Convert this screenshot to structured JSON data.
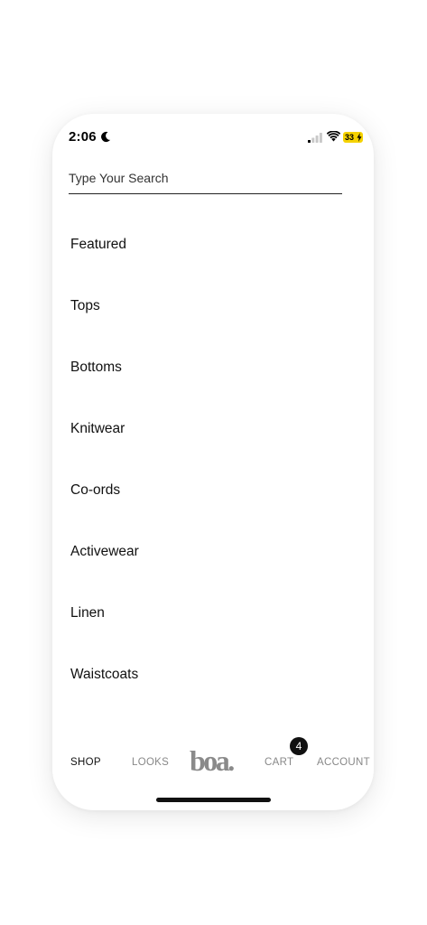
{
  "status_bar": {
    "time": "2:06",
    "battery_level": "33",
    "icons": [
      "moon-icon",
      "signal-icon",
      "wifi-icon",
      "battery-charging-icon"
    ]
  },
  "search": {
    "placeholder": "Type Your Search",
    "value": ""
  },
  "categories": [
    {
      "label": "Featured"
    },
    {
      "label": "Tops"
    },
    {
      "label": "Bottoms"
    },
    {
      "label": "Knitwear"
    },
    {
      "label": "Co-ords"
    },
    {
      "label": "Activewear"
    },
    {
      "label": "Linen"
    },
    {
      "label": "Waistcoats"
    }
  ],
  "bottom_nav": {
    "shop": "SHOP",
    "looks": "LOOKS",
    "logo": "boa.",
    "cart": "CART",
    "cart_count": "4",
    "account": "ACCOUNT",
    "active": "shop"
  },
  "colors": {
    "text": "#111111",
    "inactive_nav": "#888888",
    "logo": "#8a8a8a",
    "battery": "#f5d200",
    "badge": "#111111"
  }
}
